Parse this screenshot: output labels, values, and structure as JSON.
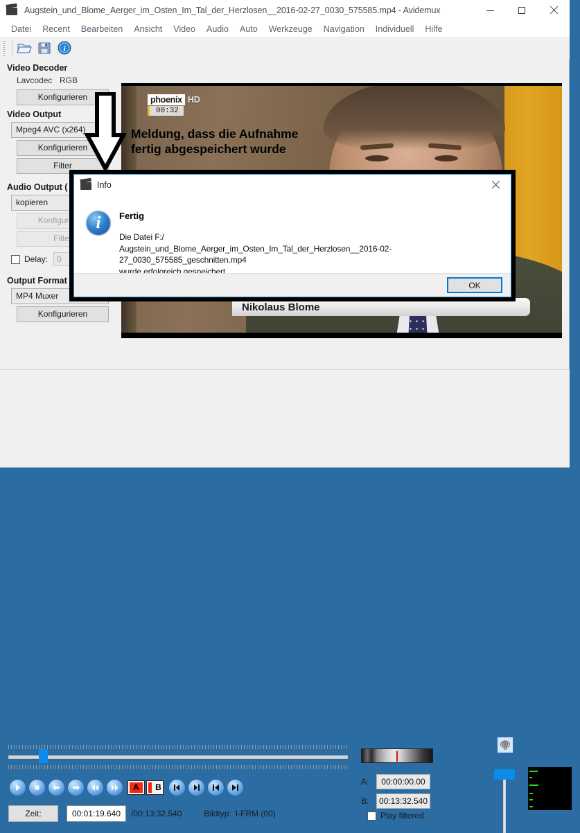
{
  "window": {
    "title": "Augstein_und_Blome_Aerger_im_Osten_Im_Tal_der_Herzlosen__2016-02-27_0030_575585.mp4 - Avidemux",
    "icon": "clapperboard-icon",
    "minimize_label": "minimize-icon",
    "maximize_label": "maximize-icon",
    "close_label": "close-icon"
  },
  "menubar": {
    "items": [
      {
        "label": "Datei"
      },
      {
        "label": "Recent"
      },
      {
        "label": "Bearbeiten"
      },
      {
        "label": "Ansicht"
      },
      {
        "label": "Video"
      },
      {
        "label": "Audio"
      },
      {
        "label": "Auto"
      },
      {
        "label": "Werkzeuge"
      },
      {
        "label": "Navigation"
      },
      {
        "label": "Individuell"
      },
      {
        "label": "Hilfe"
      }
    ]
  },
  "toolbar": {
    "buttons": [
      {
        "name": "open-file-icon",
        "tooltip": "Datei öffnen"
      },
      {
        "name": "save-file-icon",
        "tooltip": "Speichern"
      },
      {
        "name": "info-icon",
        "tooltip": "Info"
      }
    ]
  },
  "left_panel": {
    "video_decoder": {
      "title": "Video Decoder",
      "codec": "Lavcodec",
      "colorspace": "RGB",
      "configure_label": "Konfigurieren"
    },
    "video_output": {
      "title": "Video Output",
      "selected": "Mpeg4 AVC (x264)",
      "configure_label": "Konfigurieren",
      "filters_label": "Filter"
    },
    "audio_output": {
      "title": "Audio Output (",
      "selected": "kopieren",
      "configure_label": "Konfigurieren",
      "filters_label": "Filter",
      "delay_label": "Delay:",
      "delay_value": "0"
    },
    "output_format": {
      "title": "Output Format",
      "selected": "MP4 Muxer",
      "configure_label": "Konfigurieren"
    }
  },
  "preview": {
    "channel_logo": "phoenix",
    "channel_hd": "HD",
    "channel_time": "00:32",
    "overlay_line1": "Meldung, dass die Aufnahme",
    "overlay_line2": "fertig abgespeichert wurde",
    "lower_third_name": "Nikolaus Blome"
  },
  "dialog": {
    "title": "Info",
    "icon": "clapperboard-icon",
    "info_icon": "info-circle-icon",
    "close_icon": "close-icon",
    "heading": "Fertig",
    "message": "Die Datei F:/\nAugstein_und_Blome_Aerger_im_Osten_Im_Tal_der_Herzlosen__2016-02-27_0030_575585_geschnitten.mp4\nwurde erfolgreich gespeichert.",
    "ok_label": "OK"
  },
  "transport": {
    "buttons": [
      {
        "name": "play-button",
        "glyph": "play"
      },
      {
        "name": "stop-button",
        "glyph": "stop"
      },
      {
        "name": "step-back-button",
        "glyph": "arrow-left"
      },
      {
        "name": "step-forward-button",
        "glyph": "arrow-right"
      },
      {
        "name": "rewind-button",
        "glyph": "double-left"
      },
      {
        "name": "fast-forward-button",
        "glyph": "double-right"
      },
      {
        "name": "mark-a-button",
        "glyph": "A"
      },
      {
        "name": "mark-b-button",
        "glyph": "B"
      },
      {
        "name": "prev-keyframe-button",
        "glyph": "skip-left"
      },
      {
        "name": "next-keyframe-button",
        "glyph": "skip-right"
      },
      {
        "name": "go-start-button",
        "glyph": "start"
      },
      {
        "name": "go-end-button",
        "glyph": "end"
      }
    ],
    "zeit_label": "Zeit:",
    "current_time": "00:01:19.640",
    "total_time": "/00:13:32.540",
    "frametype_label": "Bildtyp:",
    "frametype_value": "I-FRM (00)"
  },
  "markers": {
    "a_label": "A:",
    "a_value": "00:00:00.00",
    "b_label": "B:",
    "b_value": "00:13:32.540",
    "play_filtered_label": "Play filtered",
    "play_filtered_checked": false
  },
  "audio_panel": {
    "speaker_icon": "speaker-icon",
    "volume_slider": "volume-slider",
    "scope": "audio-scope"
  },
  "colors": {
    "accent": "#0078d7",
    "slider_blue": "#0c8ce9",
    "marker_red": "#f4280f",
    "scope_green": "#19e019",
    "wall_yellow": "#e0a522",
    "desktop_blue": "#2b6ca3"
  }
}
